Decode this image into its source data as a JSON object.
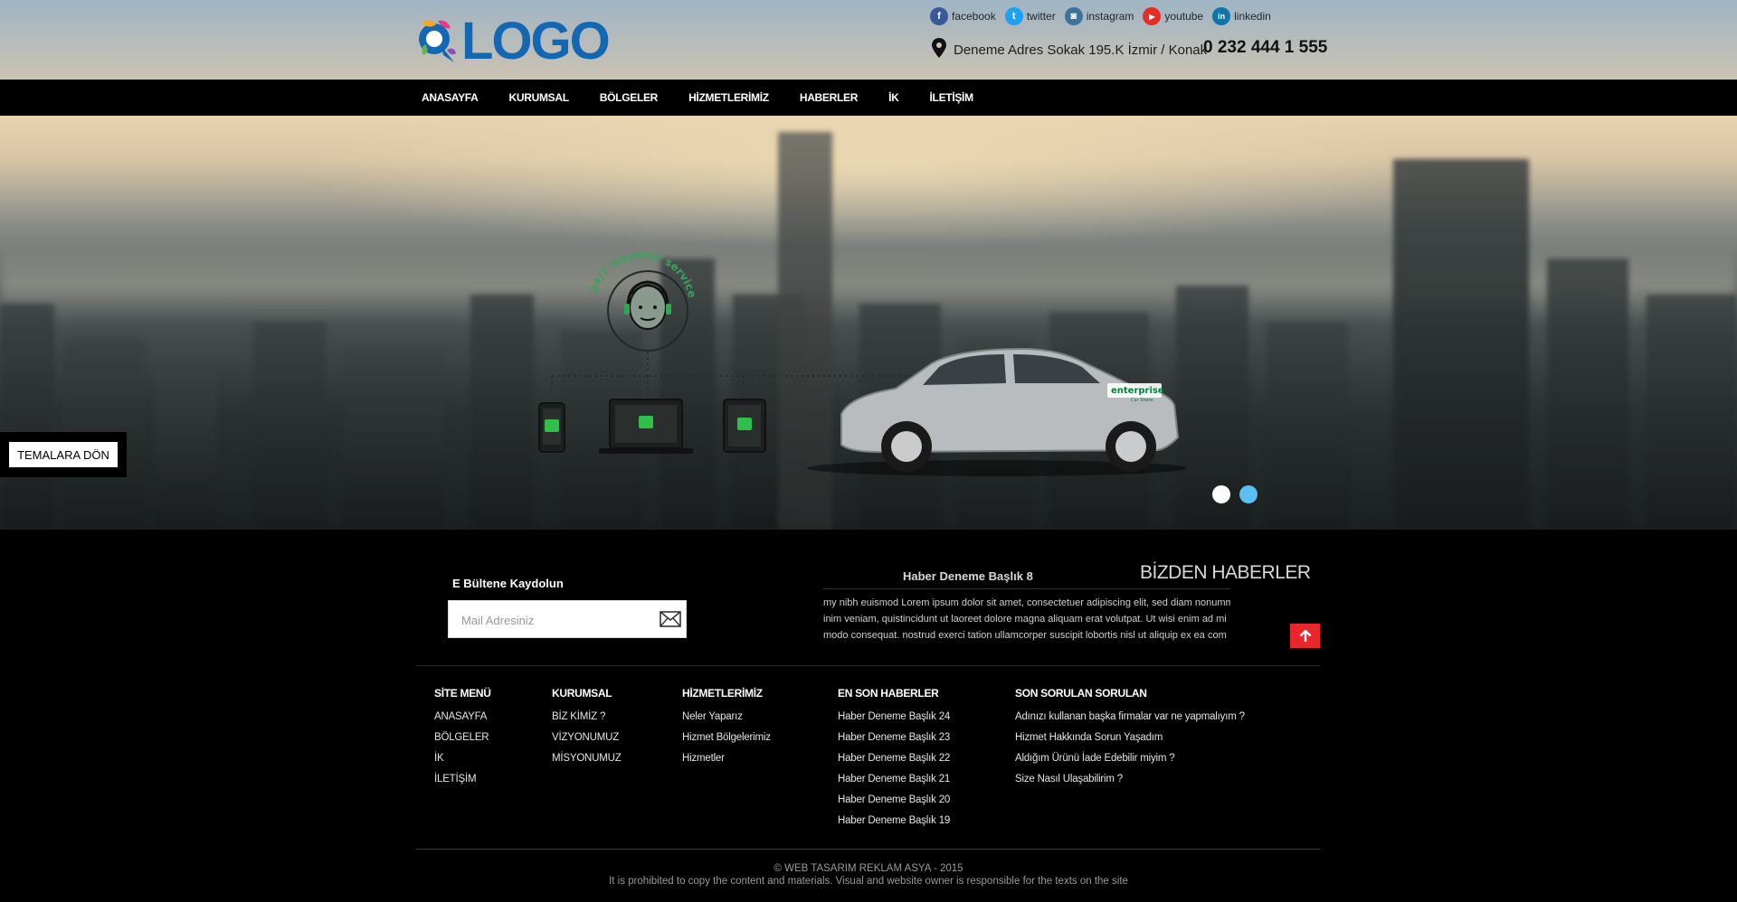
{
  "header": {
    "logo_text": "LOGO",
    "social": [
      {
        "label": "facebook",
        "icon": "facebook-icon",
        "glyph": "f",
        "color": "#3b5998"
      },
      {
        "label": "twitter",
        "icon": "twitter-icon",
        "glyph": "t",
        "color": "#1da1f2"
      },
      {
        "label": "instagram",
        "icon": "instagram-icon",
        "glyph": "◙",
        "color": "#3f729b"
      },
      {
        "label": "youtube",
        "icon": "youtube-icon",
        "glyph": "▶",
        "color": "#e52d27"
      },
      {
        "label": "linkedin",
        "icon": "linkedin-icon",
        "glyph": "in",
        "color": "#0e76a8"
      }
    ],
    "address": "Deneme Adres Sokak 195.K İzmir / Konak",
    "phone": "0 232 444 1 555"
  },
  "nav": {
    "items": [
      "ANASAYFA",
      "KURUMSAL",
      "BÖLGELER",
      "HİZMETLERİMİZ",
      "HABERLER",
      "İK",
      "İLETİŞİM"
    ]
  },
  "slider": {
    "theme_button": "TEMALARA DÖN",
    "badge_text": "24/7 member service",
    "car_brand": "enterprise",
    "car_sub": "Car Share",
    "active_dot": 0,
    "dot_colors": [
      "#ffffff",
      "#5bc0f0"
    ]
  },
  "footer": {
    "newsletter_title": "E Bültene Kaydolun",
    "newsletter_placeholder": "Mail Adresiniz",
    "news_heading": "BİZDEN HABERLER",
    "news_title": "Haber Deneme Başlık 8",
    "news_lines": [
      "my nibh euismod  Lorem ipsum dolor sit amet, consectetuer adipiscing elit, sed diam nonummy",
      "inim veniam, quistincidunt ut laoreet dolore magna aliquam erat volutpat. Ut wisi enim ad mi",
      "modo consequat. nostrud exerci tation ullamcorper suscipit lobortis nisl ut aliquip ex ea com"
    ],
    "columns": [
      {
        "title": "SİTE MENÜ",
        "items": [
          "ANASAYFA",
          "BÖLGELER",
          "İK",
          "İLETİŞİM"
        ]
      },
      {
        "title": "KURUMSAL",
        "items": [
          "BİZ KİMİZ ?",
          "VİZYONUMUZ",
          "MİSYONUMUZ"
        ]
      },
      {
        "title": "HİZMETLERİMİZ",
        "items": [
          "Neler Yaparız",
          "Hizmet Bölgelerimiz",
          "Hizmetler"
        ]
      },
      {
        "title": "EN SON HABERLER",
        "items": [
          "Haber Deneme Başlık 24",
          "Haber Deneme Başlık 23",
          "Haber Deneme Başlık 22",
          "Haber Deneme Başlık 21",
          "Haber Deneme Başlık 20",
          "Haber Deneme Başlık 19"
        ]
      },
      {
        "title": "SON SORULAN SORULAN",
        "items": [
          "Adınızı kullanan başka firmalar var ne yapmalıyım ?",
          "Hizmet Hakkında Sorun Yaşadım",
          "Aldığım Ürünü İade Edebilir miyim ?",
          "Size Nasıl Ulaşabilirim ?"
        ]
      }
    ],
    "copyright": "© WEB TASARIM REKLAM ASYA - 2015",
    "notice": "It is prohibited to copy the content and materials. Visual and website owner is responsible for the texts on the site"
  }
}
